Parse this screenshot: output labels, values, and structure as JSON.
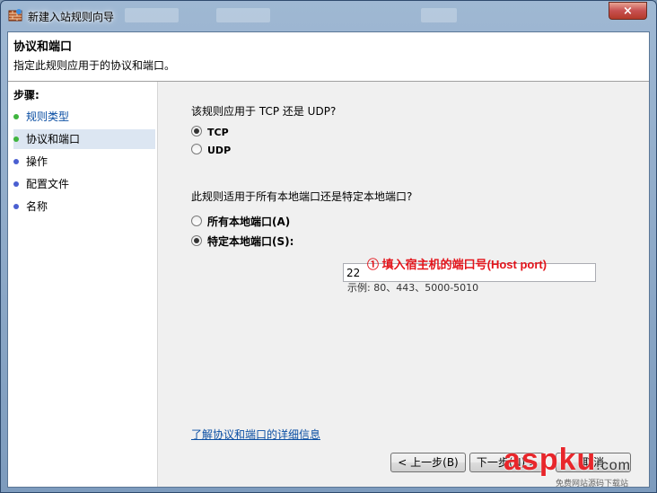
{
  "window": {
    "title": "新建入站规则向导",
    "close_symbol": "×"
  },
  "header": {
    "title": "协议和端口",
    "description": "指定此规则应用于的协议和端口。"
  },
  "steps": {
    "title": "步骤:",
    "items": [
      {
        "label": "规则类型",
        "state": "done"
      },
      {
        "label": "协议和端口",
        "state": "current"
      },
      {
        "label": "操作",
        "state": "pending"
      },
      {
        "label": "配置文件",
        "state": "pending"
      },
      {
        "label": "名称",
        "state": "pending"
      }
    ]
  },
  "protocol": {
    "question": "该规则应用于 TCP 还是 UDP?",
    "options": [
      "TCP",
      "UDP"
    ],
    "selected": "TCP"
  },
  "ports": {
    "question": "此规则适用于所有本地端口还是特定本地端口?",
    "options": [
      "所有本地端口(A)",
      "特定本地端口(S):"
    ],
    "selected": "特定本地端口(S):",
    "value": "22",
    "example": "示例: 80、443、5000-5010"
  },
  "annotation": "① 填入宿主机的端口号(Host port)",
  "info_link": "了解协议和端口的详细信息",
  "buttons": {
    "back": "< 上一步(B)",
    "next": "下一步(N) >",
    "cancel": "取消"
  },
  "watermark": {
    "main": "aspku",
    "suffix": ".com",
    "sub": "免费网站源码下载站"
  },
  "colors": {
    "done_dot": "#3fb53f",
    "pending_dot": "#4a5fd1",
    "annotation": "#e3141b",
    "link": "#0a4ea3"
  }
}
